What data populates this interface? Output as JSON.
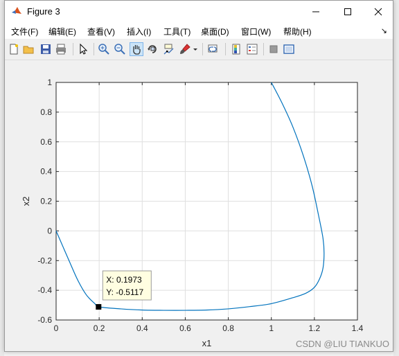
{
  "window": {
    "title": "Figure 3"
  },
  "menu": [
    {
      "label": "文件(F)"
    },
    {
      "label": "编辑(E)"
    },
    {
      "label": "查看(V)"
    },
    {
      "label": "插入(I)"
    },
    {
      "label": "工具(T)"
    },
    {
      "label": "桌面(D)"
    },
    {
      "label": "窗口(W)"
    },
    {
      "label": "帮助(H)"
    }
  ],
  "menu_overflow_icon": "double-chevron-icon",
  "toolbar_icons": [
    "new-figure-icon",
    "open-icon",
    "save-icon",
    "print-icon",
    "select-arrow-icon",
    "zoom-in-icon",
    "zoom-out-icon",
    "pan-hand-icon",
    "rotate-3d-icon",
    "data-cursor-icon",
    "brush-icon",
    "link-plot-icon",
    "colorbar-icon",
    "legend-icon",
    "hide-plot-tools-icon",
    "show-plot-tools-icon"
  ],
  "chart_data": {
    "type": "line",
    "xlabel": "x1",
    "ylabel": "x2",
    "xlim": [
      0,
      1.4
    ],
    "ylim": [
      -0.6,
      1
    ],
    "xticks": [
      "0",
      "0.2",
      "0.4",
      "0.6",
      "0.8",
      "1",
      "1.2",
      "1.4"
    ],
    "yticks": [
      "-0.6",
      "-0.4",
      "-0.2",
      "0",
      "0.2",
      "0.4",
      "0.6",
      "0.8",
      "1"
    ],
    "grid": true,
    "line_color": "#0072bd",
    "series": [
      {
        "x": [
          1.0,
          1.05,
          1.1,
          1.15,
          1.19,
          1.22,
          1.24,
          1.245,
          1.24,
          1.225,
          1.2,
          1.16,
          1.1,
          1.0,
          0.9,
          0.8,
          0.7,
          0.6,
          0.5,
          0.4,
          0.3,
          0.2,
          0.18,
          0.14,
          0.1,
          0.06,
          0.03,
          0.0
        ],
        "y": [
          1.0,
          0.86,
          0.7,
          0.5,
          0.3,
          0.1,
          -0.05,
          -0.15,
          -0.25,
          -0.32,
          -0.38,
          -0.42,
          -0.45,
          -0.49,
          -0.51,
          -0.525,
          -0.533,
          -0.535,
          -0.535,
          -0.533,
          -0.525,
          -0.512,
          -0.49,
          -0.43,
          -0.33,
          -0.2,
          -0.1,
          0.0
        ]
      }
    ],
    "datatip": {
      "x": 0.1973,
      "y": -0.5117,
      "label_x": "X: 0.1973",
      "label_y": "Y: -0.5117"
    }
  },
  "watermark": "CSDN @LIU TIANKUO"
}
